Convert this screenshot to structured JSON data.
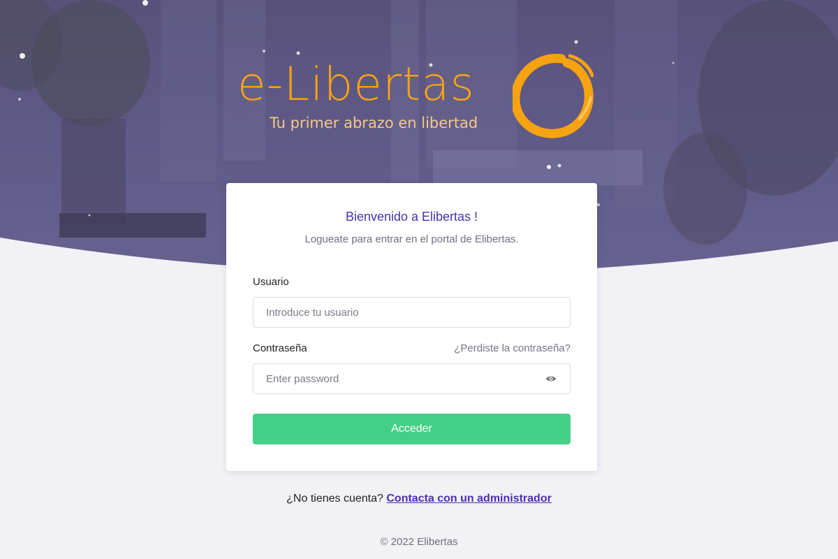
{
  "brand": {
    "logo_text": "e-Libertas",
    "tagline": "Tu primer abrazo en libertad",
    "color": "#f6a211"
  },
  "card": {
    "title": "Bienvenido a Elibertas !",
    "subtitle": "Logueate para entrar en el portal de Elibertas."
  },
  "form": {
    "username_label": "Usuario",
    "username_placeholder": "Introduce tu usuario",
    "username_value": "",
    "password_label": "Contraseña",
    "password_placeholder": "Enter password",
    "password_value": "",
    "forgot_link": "¿Perdiste la contraseña?",
    "submit_label": "Acceder",
    "password_toggle_icon": "eye-icon"
  },
  "signup": {
    "prompt": "¿No tienes cuenta?",
    "link": "Contacta con un administrador"
  },
  "footer": {
    "copyright": "© 2022 Elibertas"
  },
  "colors": {
    "accent": "#4b2fb4",
    "button": "#44cf86",
    "hero": "#5f5986",
    "page_background": "#f1f1f6"
  }
}
